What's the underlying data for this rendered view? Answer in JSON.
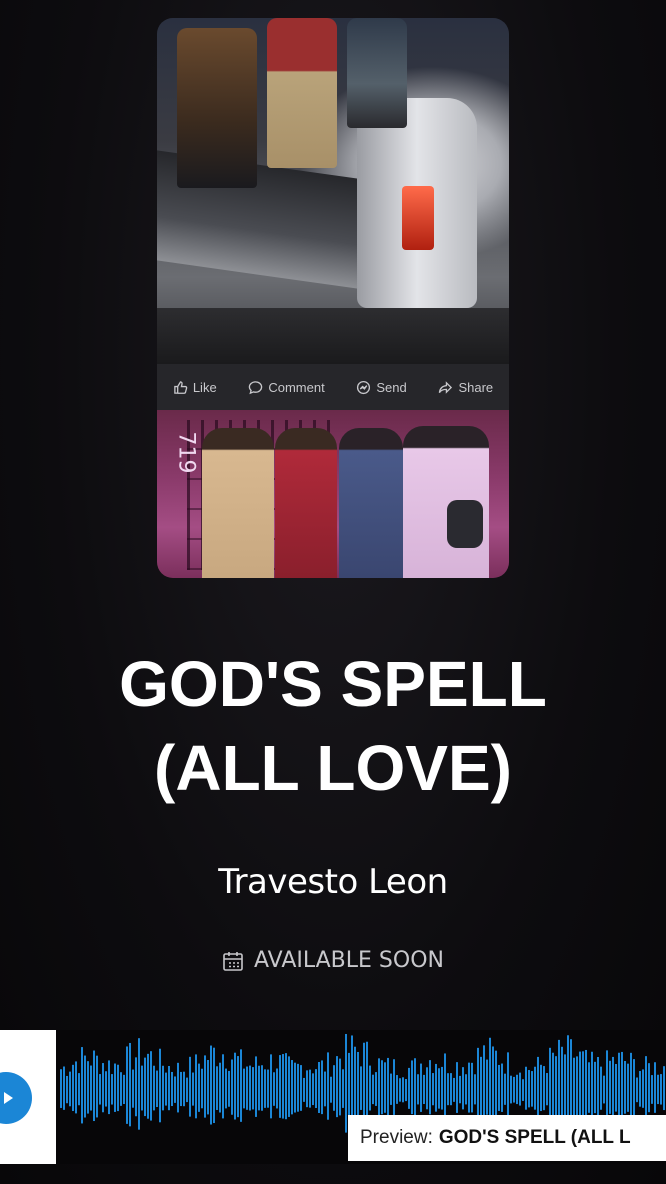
{
  "post": {
    "actions": [
      {
        "label": "Like",
        "icon": "thumbs-up-icon"
      },
      {
        "label": "Comment",
        "icon": "speech-bubble-icon"
      },
      {
        "label": "Send",
        "icon": "messenger-icon"
      },
      {
        "label": "Share",
        "icon": "share-arrow-icon"
      }
    ],
    "photo_bottom_graffiti": "719"
  },
  "track": {
    "title_line1": "GOD'S SPELL",
    "title_line2": "(ALL LOVE)",
    "artist": "Travesto Leon",
    "availability": "AVAILABLE SOON",
    "availability_icon": "calendar-icon"
  },
  "player": {
    "play_icon": "play-icon",
    "preview_prefix": "Preview:",
    "preview_title": "GOD'S SPELL (ALL L",
    "accent_color": "#1b86d6"
  }
}
